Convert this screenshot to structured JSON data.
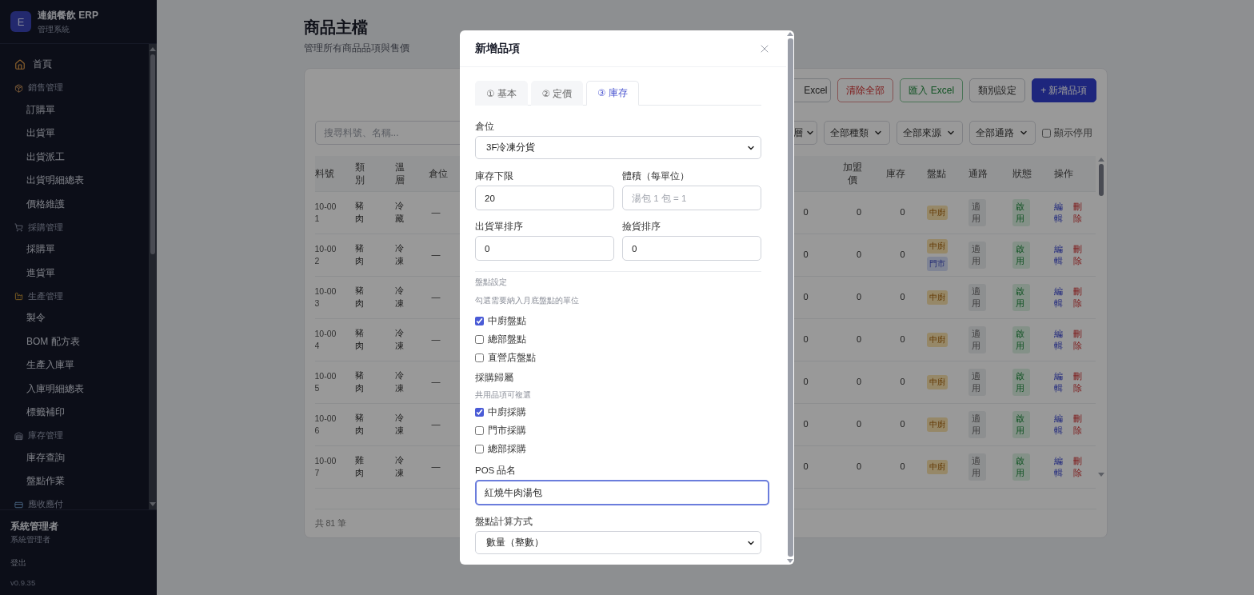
{
  "sidebar": {
    "logo_letter": "E",
    "title": "連鎖餐飲 ERP",
    "subtitle": "管理系統",
    "nav": [
      {
        "kind": "home",
        "label": "首頁"
      },
      {
        "kind": "group",
        "label": "銷售管理"
      },
      {
        "kind": "link",
        "label": "訂購單"
      },
      {
        "kind": "link",
        "label": "出貨單"
      },
      {
        "kind": "link",
        "label": "出貨派工"
      },
      {
        "kind": "link",
        "label": "出貨明細總表"
      },
      {
        "kind": "link",
        "label": "價格維護"
      },
      {
        "kind": "group",
        "label": "採購管理"
      },
      {
        "kind": "link",
        "label": "採購單"
      },
      {
        "kind": "link",
        "label": "進貨單"
      },
      {
        "kind": "group",
        "label": "生產管理"
      },
      {
        "kind": "link",
        "label": "製令"
      },
      {
        "kind": "link",
        "label": "BOM 配方表"
      },
      {
        "kind": "link",
        "label": "生產入庫單"
      },
      {
        "kind": "link",
        "label": "入庫明細總表"
      },
      {
        "kind": "link",
        "label": "標籤補印"
      },
      {
        "kind": "group",
        "label": "庫存管理"
      },
      {
        "kind": "link",
        "label": "庫存查詢"
      },
      {
        "kind": "link",
        "label": "盤點作業"
      },
      {
        "kind": "group",
        "label": "應收應付"
      }
    ],
    "user": {
      "name": "系統管理者",
      "role": "系統管理者"
    },
    "logout": "登出",
    "version": "v0.9.35"
  },
  "page": {
    "title": "商品主檔",
    "subtitle": "管理所有商品品項與售價"
  },
  "toolbar": [
    {
      "label": "Excel",
      "kind": "outline"
    },
    {
      "label": "清除全部",
      "kind": "danger"
    },
    {
      "label": "匯入 Excel",
      "kind": "success"
    },
    {
      "label": "類別設定",
      "kind": "outline"
    },
    {
      "label": "+ 新增品項",
      "kind": "primary"
    }
  ],
  "filters": {
    "search_placeholder": "搜尋料號、名稱...",
    "selects": [
      "層",
      "全部種類",
      "全部來源",
      "全部通路"
    ],
    "show_disabled": {
      "label": "顯示停用",
      "checked": false
    }
  },
  "table": {
    "columns_left": [
      "料號",
      "類別",
      "溫層",
      "倉位"
    ],
    "columns_right": [
      "加盟價",
      "庫存",
      "盤點",
      "通路",
      "狀態",
      "操作"
    ],
    "rows": [
      {
        "code": "10-001",
        "category": "豬肉",
        "temp": "冷藏",
        "location": "—",
        "column_5": "0",
        "franchise_price": "0",
        "stock": "0",
        "count_tags": [
          {
            "label": "中廚"
          }
        ],
        "channel": "適用",
        "status": "啟用",
        "actions": [
          "編輯",
          "刪除"
        ]
      },
      {
        "code": "10-002",
        "category": "豬肉",
        "temp": "冷凍",
        "location": "—",
        "column_5": "0",
        "franchise_price": "0",
        "stock": "0",
        "count_tags": [
          {
            "label": "中廚"
          },
          {
            "label": "門市"
          }
        ],
        "channel": "適用",
        "status": "啟用",
        "actions": [
          "編輯",
          "刪除"
        ]
      },
      {
        "code": "10-003",
        "category": "豬肉",
        "temp": "冷凍",
        "location": "—",
        "column_5": "0",
        "franchise_price": "0",
        "stock": "0",
        "count_tags": [
          {
            "label": "中廚"
          }
        ],
        "channel": "適用",
        "status": "啟用",
        "actions": [
          "編輯",
          "刪除"
        ]
      },
      {
        "code": "10-004",
        "category": "豬肉",
        "temp": "冷凍",
        "location": "—",
        "column_5": "0",
        "franchise_price": "0",
        "stock": "0",
        "count_tags": [
          {
            "label": "中廚"
          }
        ],
        "channel": "適用",
        "status": "啟用",
        "actions": [
          "編輯",
          "刪除"
        ]
      },
      {
        "code": "10-005",
        "category": "豬肉",
        "temp": "冷凍",
        "location": "—",
        "column_5": "0",
        "franchise_price": "0",
        "stock": "0",
        "count_tags": [
          {
            "label": "中廚"
          }
        ],
        "channel": "適用",
        "status": "啟用",
        "actions": [
          "編輯",
          "刪除"
        ]
      },
      {
        "code": "10-006",
        "category": "豬肉",
        "temp": "冷凍",
        "location": "—",
        "column_5": "0",
        "franchise_price": "0",
        "stock": "0",
        "count_tags": [
          {
            "label": "中廚"
          }
        ],
        "channel": "適用",
        "status": "啟用",
        "actions": [
          "編輯",
          "刪除"
        ]
      },
      {
        "code": "10-007",
        "category": "雞肉",
        "temp": "冷凍",
        "location": "—",
        "column_5": "0",
        "franchise_price": "0",
        "stock": "0",
        "count_tags": [
          {
            "label": "中廚"
          }
        ],
        "channel": "適用",
        "status": "啟用",
        "actions": [
          "編輯",
          "刪除"
        ]
      }
    ],
    "total": "共 81 筆"
  },
  "modal": {
    "title": "新增品項",
    "tabs": [
      {
        "label": "① 基本",
        "selected": false
      },
      {
        "label": "② 定價",
        "selected": false
      },
      {
        "label": "③ 庫存",
        "selected": true
      }
    ],
    "warehouse": {
      "label": "倉位",
      "value": "3F冷凍分貨"
    },
    "pairs": [
      [
        {
          "label": "庫存下限",
          "value": "20"
        },
        {
          "label": "體積（每單位）",
          "placeholder": "湯包 1 包 = 1"
        }
      ],
      [
        {
          "label": "出貨單排序",
          "value": "0"
        },
        {
          "label": "撿貨排序",
          "value": "0"
        }
      ]
    ],
    "inventory_check": {
      "title": "盤點設定",
      "hint": "勾選需要納入月底盤點的單位",
      "options": [
        {
          "label": "中廚盤點",
          "checked": true
        },
        {
          "label": "總部盤點",
          "checked": false
        },
        {
          "label": "直營店盤點",
          "checked": false
        }
      ]
    },
    "purchase": {
      "title": "採購歸屬",
      "hint": "共用品項可複選",
      "options": [
        {
          "label": "中廚採購",
          "checked": true
        },
        {
          "label": "門市採購",
          "checked": false
        },
        {
          "label": "總部採購",
          "checked": false
        }
      ]
    },
    "pos_name": {
      "label": "POS 品名",
      "value": "紅燒牛肉湯包",
      "focused": true
    },
    "count_method": {
      "label": "盤點計算方式",
      "value": "數量（整數）"
    }
  }
}
